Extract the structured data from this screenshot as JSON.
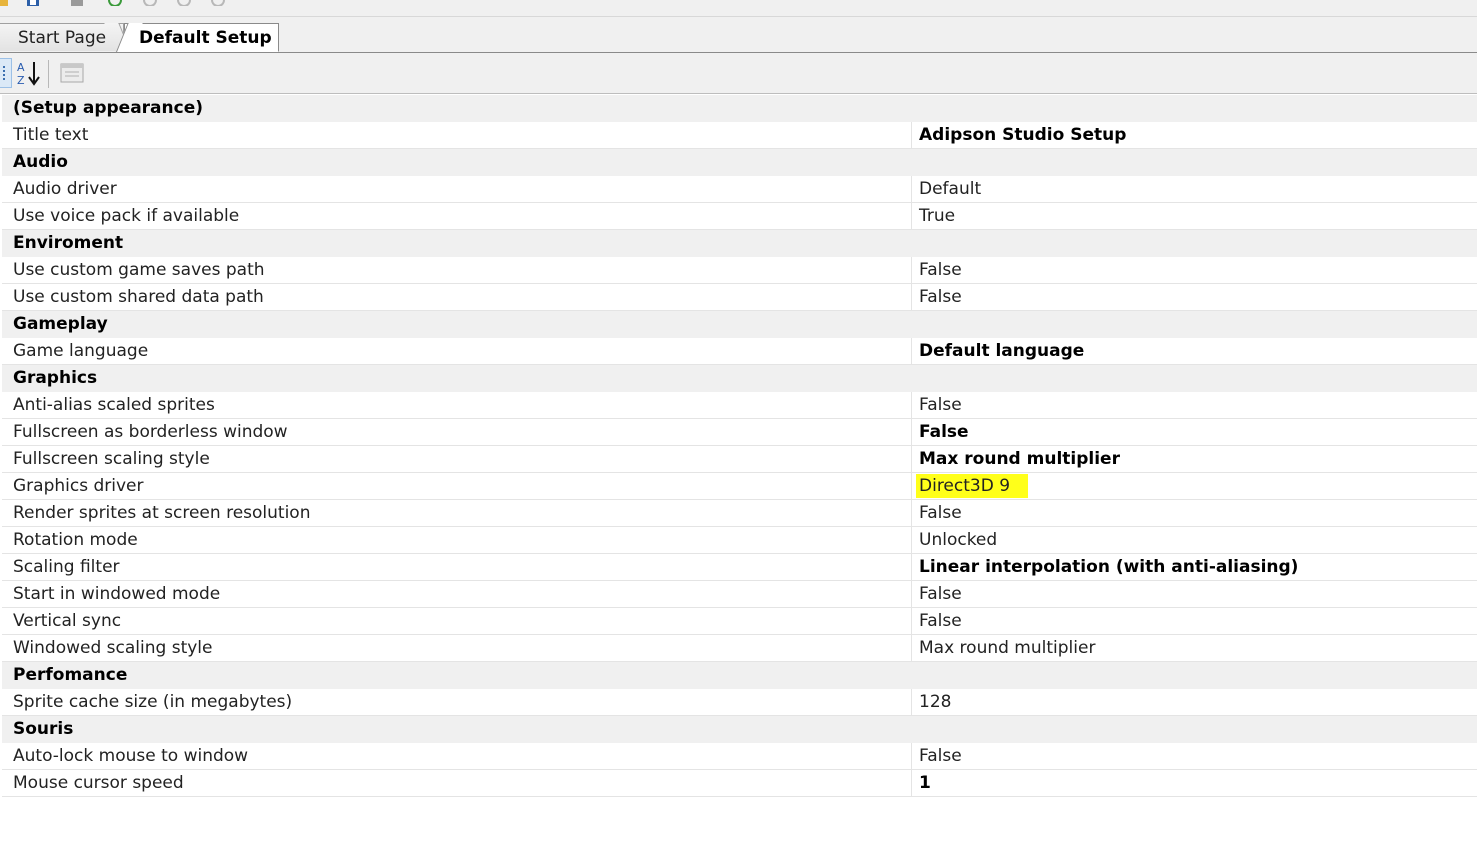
{
  "tabs": [
    {
      "label": "Start Page",
      "active": false
    },
    {
      "label": "Default Setup",
      "active": true
    }
  ],
  "toolbar": {
    "categorized_icon": "categorized-icon",
    "sort_icon": "sort-alphabetical-icon",
    "pages_icon": "property-pages-icon"
  },
  "colors": {
    "highlight": "#ffff1a",
    "category_bg": "#f0f0f0"
  },
  "grid": {
    "rows": [
      {
        "type": "category",
        "label": "(Setup appearance)"
      },
      {
        "type": "property",
        "name": "Title text",
        "value": "Adipson Studio Setup",
        "bold": true
      },
      {
        "type": "category",
        "label": "Audio"
      },
      {
        "type": "property",
        "name": "Audio driver",
        "value": "Default",
        "bold": false
      },
      {
        "type": "property",
        "name": "Use voice pack if available",
        "value": "True",
        "bold": false
      },
      {
        "type": "category",
        "label": "Enviroment"
      },
      {
        "type": "property",
        "name": "Use custom game saves path",
        "value": "False",
        "bold": false
      },
      {
        "type": "property",
        "name": "Use custom shared data path",
        "value": "False",
        "bold": false
      },
      {
        "type": "category",
        "label": "Gameplay"
      },
      {
        "type": "property",
        "name": "Game language",
        "value": "Default language",
        "bold": true
      },
      {
        "type": "category",
        "label": "Graphics"
      },
      {
        "type": "property",
        "name": "Anti-alias scaled sprites",
        "value": "False",
        "bold": false
      },
      {
        "type": "property",
        "name": "Fullscreen as borderless window",
        "value": "False",
        "bold": true
      },
      {
        "type": "property",
        "name": "Fullscreen scaling style",
        "value": "Max round multiplier",
        "bold": true
      },
      {
        "type": "property",
        "name": "Graphics driver",
        "value": "Direct3D 9",
        "bold": false,
        "highlight": true
      },
      {
        "type": "property",
        "name": "Render sprites at screen resolution",
        "value": "False",
        "bold": false
      },
      {
        "type": "property",
        "name": "Rotation mode",
        "value": "Unlocked",
        "bold": false
      },
      {
        "type": "property",
        "name": "Scaling filter",
        "value": "Linear interpolation (with anti-aliasing)",
        "bold": true
      },
      {
        "type": "property",
        "name": "Start in windowed mode",
        "value": "False",
        "bold": false
      },
      {
        "type": "property",
        "name": "Vertical sync",
        "value": "False",
        "bold": false
      },
      {
        "type": "property",
        "name": "Windowed scaling style",
        "value": "Max round multiplier",
        "bold": false
      },
      {
        "type": "category",
        "label": "Perfomance"
      },
      {
        "type": "property",
        "name": "Sprite cache size (in megabytes)",
        "value": "128",
        "bold": false
      },
      {
        "type": "category",
        "label": "Souris"
      },
      {
        "type": "property",
        "name": "Auto-lock mouse to window",
        "value": "False",
        "bold": false
      },
      {
        "type": "property",
        "name": "Mouse cursor speed",
        "value": "1",
        "bold": true
      }
    ]
  }
}
